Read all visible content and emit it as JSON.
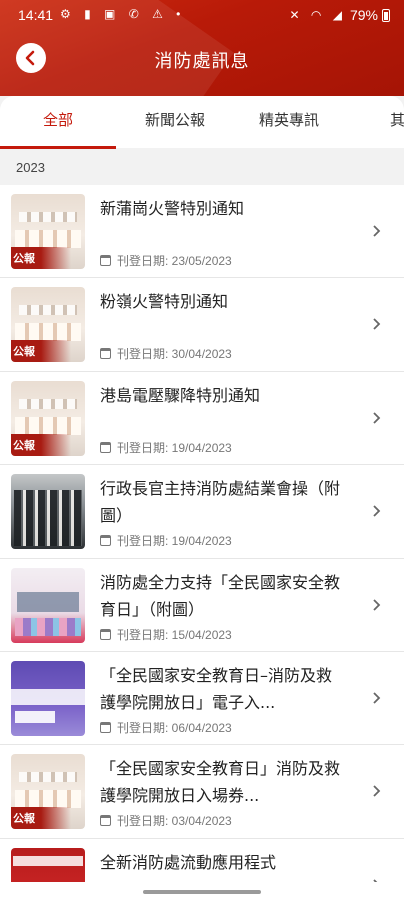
{
  "statusbar": {
    "time": "14:41",
    "battery": "79%",
    "left_icons": [
      "settings-icon",
      "lock-icon",
      "photo-icon",
      "wifi-calling-icon",
      "warning-icon",
      "dot-icon"
    ],
    "right_icons": [
      "mute-icon",
      "wifi-icon",
      "signal-icon"
    ]
  },
  "header": {
    "title": "消防處訊息",
    "background": "#c41a0c",
    "back_icon": "chevron-left-icon"
  },
  "tabs": [
    {
      "label": "全部",
      "active": true
    },
    {
      "label": "新聞公報",
      "active": false
    },
    {
      "label": "精英專訊",
      "active": false
    },
    {
      "label": "其",
      "active": false
    }
  ],
  "accent": "#c41a0c",
  "year_label": "2023",
  "items": [
    {
      "title": "新蒲崗火警特別通知",
      "date": "刊登日期: 23/05/2023",
      "thumb": "press",
      "badge": "公報"
    },
    {
      "title": "粉嶺火警特別通知",
      "date": "刊登日期: 30/04/2023",
      "thumb": "press",
      "badge": "公報"
    },
    {
      "title": "港島電壓驟降特別通知",
      "date": "刊登日期: 19/04/2023",
      "thumb": "press",
      "badge": "公報"
    },
    {
      "title": "行政長官主持消防處結業會操（附圖）",
      "date": "刊登日期: 19/04/2023",
      "thumb": "ceremony",
      "badge": ""
    },
    {
      "title": "消防處全力支持「全民國家安全教育日」（附圖）",
      "date": "刊登日期: 15/04/2023",
      "thumb": "nsed",
      "badge": ""
    },
    {
      "title": "「全民國家安全教育日–消防及救護學院開放日」電子入...",
      "date": "刊登日期: 06/04/2023",
      "thumb": "purple",
      "badge": ""
    },
    {
      "title": "「全民國家安全教育日」消防及救護學院開放日入場券...",
      "date": "刊登日期: 03/04/2023",
      "thumb": "press",
      "badge": "公報"
    },
    {
      "title": "全新消防處流動應用程式",
      "date": "",
      "thumb": "app",
      "badge": ""
    }
  ]
}
